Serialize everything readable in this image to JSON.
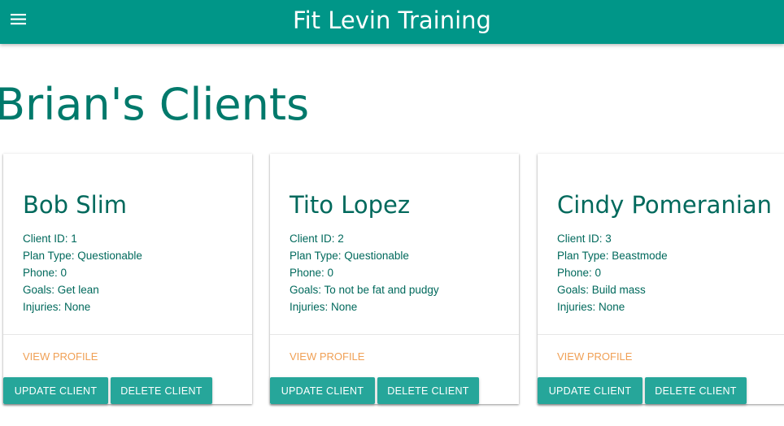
{
  "app": {
    "title": "Fit Levin Training",
    "menu_icon": "hamburger-menu-icon",
    "bar_color": "#009688"
  },
  "page": {
    "title": "Brian's Clients"
  },
  "clients": [
    {
      "name": "Bob Slim",
      "client_id": "Client ID: 1",
      "plan_type": "Plan Type: Questionable",
      "phone": "Phone: 0",
      "goals": "Goals: Get lean",
      "injuries": "Injuries: None",
      "view_label": "VIEW PROFILE",
      "update_label": "UPDATE CLIENT",
      "delete_label": "DELETE CLIENT"
    },
    {
      "name": "Tito Lopez",
      "client_id": "Client ID: 2",
      "plan_type": "Plan Type: Questionable",
      "phone": "Phone: 0",
      "goals": "Goals: To not be fat and pudgy",
      "injuries": "Injuries: None",
      "view_label": "VIEW PROFILE",
      "update_label": "UPDATE CLIENT",
      "delete_label": "DELETE CLIENT"
    },
    {
      "name": "Cindy Pomeranian",
      "client_id": "Client ID: 3",
      "plan_type": "Plan Type: Beastmode",
      "phone": "Phone: 0",
      "goals": "Goals: Build mass",
      "injuries": "Injuries: None",
      "view_label": "VIEW PROFILE",
      "update_label": "UPDATE CLIENT",
      "delete_label": "DELETE CLIENT"
    }
  ],
  "colors": {
    "accent": "#26a69a",
    "heading": "#00796b",
    "link": "#f0a055"
  }
}
